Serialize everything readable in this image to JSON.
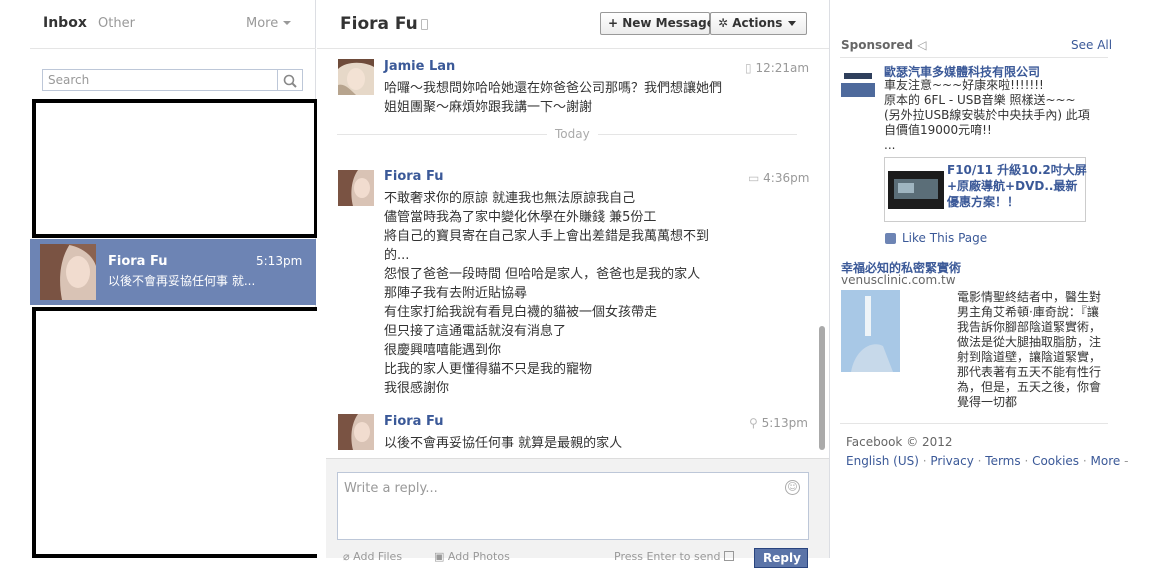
{
  "inbox": {
    "tab_inbox": "Inbox",
    "tab_other": "Other",
    "more_label": "More",
    "search_placeholder": "Search",
    "selected_thread": {
      "name": "Fiora Fu",
      "time": "5:13pm",
      "snippet": "以後不會再妥協任何事 就..."
    }
  },
  "conversation": {
    "title": "Fiora Fu",
    "new_message_label": "+ New Message",
    "actions_label": "Actions",
    "divider_label": "Today",
    "messages": [
      {
        "sender": "Jamie Lan",
        "time": "12:21am",
        "lines": [
          "哈囉～我想問妳哈哈她還在妳爸爸公司那嗎？我們想讓她們",
          "姐姐團聚～麻煩妳跟我講一下～謝謝"
        ]
      },
      {
        "sender": "Fiora Fu",
        "time": "4:36pm",
        "lines": [
          "不敢奢求你的原諒 就連我也無法原諒我自己",
          "儘管當時我為了家中變化休學在外賺錢 兼5份工",
          "將自己的寶貝寄在自己家人手上會出差錯是我萬萬想不到",
          "的...",
          "怨恨了爸爸一段時間 但哈哈是家人，爸爸也是我的家人",
          "那陣子我有去附近貼協尋",
          "有住家打給我說有看見白襪的貓被一個女孩帶走",
          "但只接了這通電話就沒有消息了",
          "很慶興嘻嘻能遇到你",
          "比我的家人更懂得貓不只是我的寵物",
          "我很感謝你"
        ]
      },
      {
        "sender": "Fiora Fu",
        "time": "5:13pm",
        "lines": [
          "以後不會再妥協任何事 就算是最親的家人"
        ]
      }
    ],
    "composer": {
      "placeholder": "Write a reply...",
      "add_files": "Add Files",
      "add_photos": "Add Photos",
      "press_enter": "Press Enter to send",
      "reply_label": "Reply"
    }
  },
  "sidebar": {
    "sponsored_label": "Sponsored",
    "see_all": "See All",
    "ad1": {
      "title": "歐瑟汽車多媒體科技有限公司",
      "body": [
        "車友注意~~~好康來啦!!!!!!!",
        "原本的 6FL - USB音樂 照樣送~~~",
        "(另外拉USB線安裝於中央扶手內) 此項",
        "自價值19000元唷!!",
        "..."
      ]
    },
    "ad2": {
      "title": "F10/11 升級10.2吋大屏+原廠導航+DVD..最新優惠方案！！"
    },
    "like_page": "Like This Page",
    "ad3": {
      "title": "幸福必知的私密緊實術",
      "domain": "venusclinic.com.tw",
      "body": "電影情聖終結者中，醫生對男主角艾希頓·庫奇說：『讓我告訴你腳部陰道緊實術，做法是從大腿抽取脂肪，注射到陰道壁，讓陰道緊實，那代表著有五天不能有性行為，但是，五天之後，你會覺得一切都"
    },
    "footer": {
      "copyright": "Facebook © 2012",
      "links": [
        "English (US)",
        "Privacy",
        "Terms",
        "Cookies",
        "More"
      ]
    }
  },
  "colors": {
    "selected_thread_bg": "#6d84b4",
    "link_blue": "#3b5998",
    "reply_button": "#5b74a8"
  }
}
